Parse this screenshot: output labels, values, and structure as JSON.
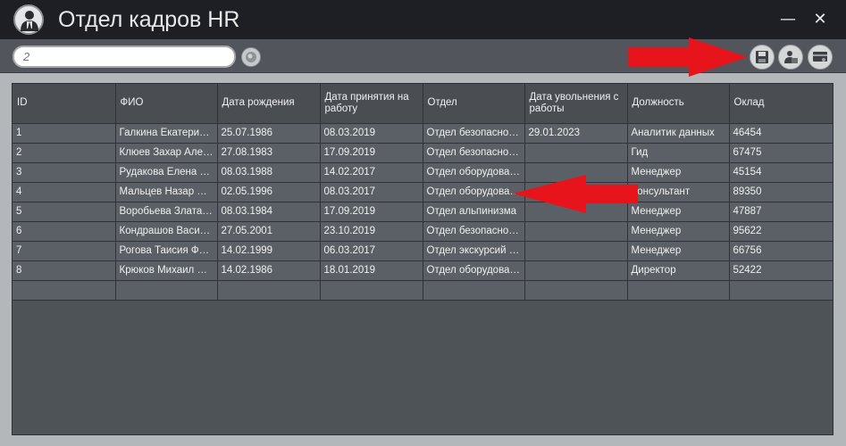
{
  "window": {
    "title": "Отдел кадров HR",
    "minimize_glyph": "—",
    "close_glyph": "✕"
  },
  "toolbar": {
    "search_value": "2",
    "icons": [
      "search-icon",
      "save-icon",
      "user-card-icon",
      "card-icon"
    ]
  },
  "table": {
    "columns": [
      "ID",
      "ФИО",
      "Дата рождения",
      "Дата принятия на работу",
      "Отдел",
      "Дата увольнения с работы",
      "Должность",
      "Оклад"
    ],
    "rows": [
      [
        "1",
        "Галкина Екатерин…",
        "25.07.1986",
        "08.03.2019",
        "Отдел безопасности",
        "29.01.2023",
        "Аналитик данных",
        "46454"
      ],
      [
        "2",
        "Клюев Захар Алек…",
        "27.08.1983",
        "17.09.2019",
        "Отдел безопасности",
        "",
        "Гид",
        "67475"
      ],
      [
        "3",
        "Рудакова Елена П…",
        "08.03.1988",
        "14.02.2017",
        "Отдел оборудования",
        "",
        "Менеджер",
        "45154"
      ],
      [
        "4",
        "Мальцев Назар Д…",
        "02.05.1996",
        "08.03.2017",
        "Отдел оборудования",
        "",
        "Консультант",
        "89350"
      ],
      [
        "5",
        "Воробьева Злата …",
        "08.03.1984",
        "17.09.2019",
        "Отдел альпинизма",
        "",
        "Менеджер",
        "47887"
      ],
      [
        "6",
        "Кондрашов Васили…",
        "27.05.2001",
        "23.10.2019",
        "Отдел безопасности",
        "",
        "Менеджер",
        "95622"
      ],
      [
        "7",
        "Рогова Таисия Фе…",
        "14.02.1999",
        "06.03.2017",
        "Отдел экскурсий и…",
        "",
        "Менеджер",
        "66756"
      ],
      [
        "8",
        "Крюков Михаил Д…",
        "14.02.1986",
        "18.01.2019",
        "Отдел оборудования",
        "",
        "Директор",
        "52422"
      ]
    ]
  },
  "colors": {
    "titlebar": "#1d1f24",
    "toolbar": "#52565c",
    "grid_bg": "#4e5358",
    "cell_bg": "#5b6066",
    "annotation_arrow": "#e8141b"
  }
}
